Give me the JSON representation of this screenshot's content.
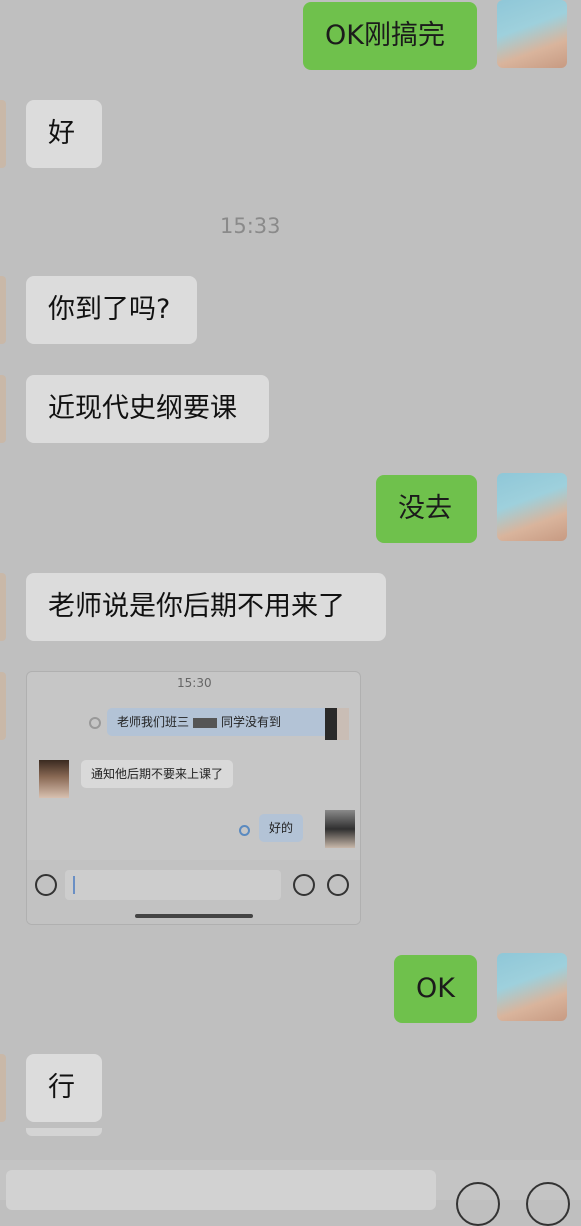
{
  "messages": [
    {
      "side": "out",
      "text": "OK刚搞完"
    },
    {
      "side": "in",
      "text": "好"
    },
    {
      "side": "in",
      "text": "你到了吗?"
    },
    {
      "side": "in",
      "text": "近现代史纲要课"
    },
    {
      "side": "out",
      "text": "没去"
    },
    {
      "side": "in",
      "text": "老师说是你后期不用来了"
    },
    {
      "side": "out",
      "text": "OK"
    },
    {
      "side": "in",
      "text": "行"
    }
  ],
  "timestamp": "15:33",
  "screenshot": {
    "time": "15:30",
    "msg1": "老师我们班三",
    "msg1b": "同学没有到",
    "msg2": "通知他后期不要来上课了",
    "msg3": "好的"
  },
  "colors": {
    "incoming_bubble": "#dcdcdc",
    "outgoing_bubble": "#6fc14c",
    "background": "#bfbfbf"
  }
}
